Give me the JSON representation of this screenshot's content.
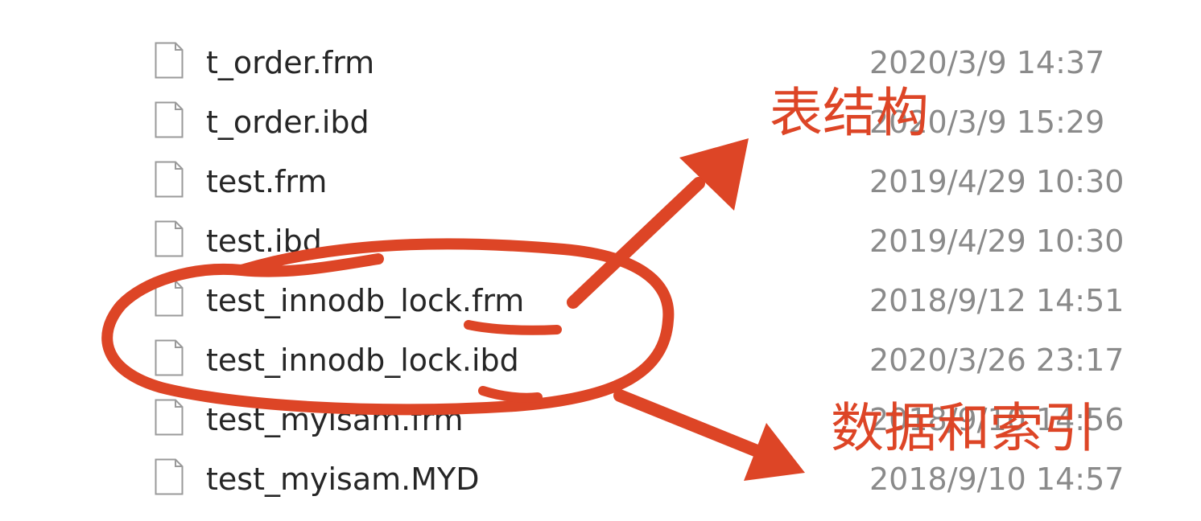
{
  "colors": {
    "annotation": "#dd4526",
    "file_name": "#262626",
    "file_date": "#8a8a8a"
  },
  "files": [
    {
      "name": "t_order.frm",
      "date": "2020/3/9 14:37",
      "icon": "file-icon"
    },
    {
      "name": "t_order.ibd",
      "date": "2020/3/9 15:29",
      "icon": "file-icon"
    },
    {
      "name": "test.frm",
      "date": "2019/4/29 10:30",
      "icon": "file-icon"
    },
    {
      "name": "test.ibd",
      "date": "2019/4/29 10:30",
      "icon": "file-icon"
    },
    {
      "name": "test_innodb_lock.frm",
      "date": "2018/9/12 14:51",
      "icon": "file-icon"
    },
    {
      "name": "test_innodb_lock.ibd",
      "date": "2020/3/26 23:17",
      "icon": "file-icon"
    },
    {
      "name": "test_myisam.frm",
      "date": "2018/9/10 14:56",
      "icon": "file-icon"
    },
    {
      "name": "test_myisam.MYD",
      "date": "2018/9/10 14:57",
      "icon": "file-icon"
    }
  ],
  "annotations": {
    "table_structure": "表结构",
    "data_and_index": "数据和索引"
  }
}
